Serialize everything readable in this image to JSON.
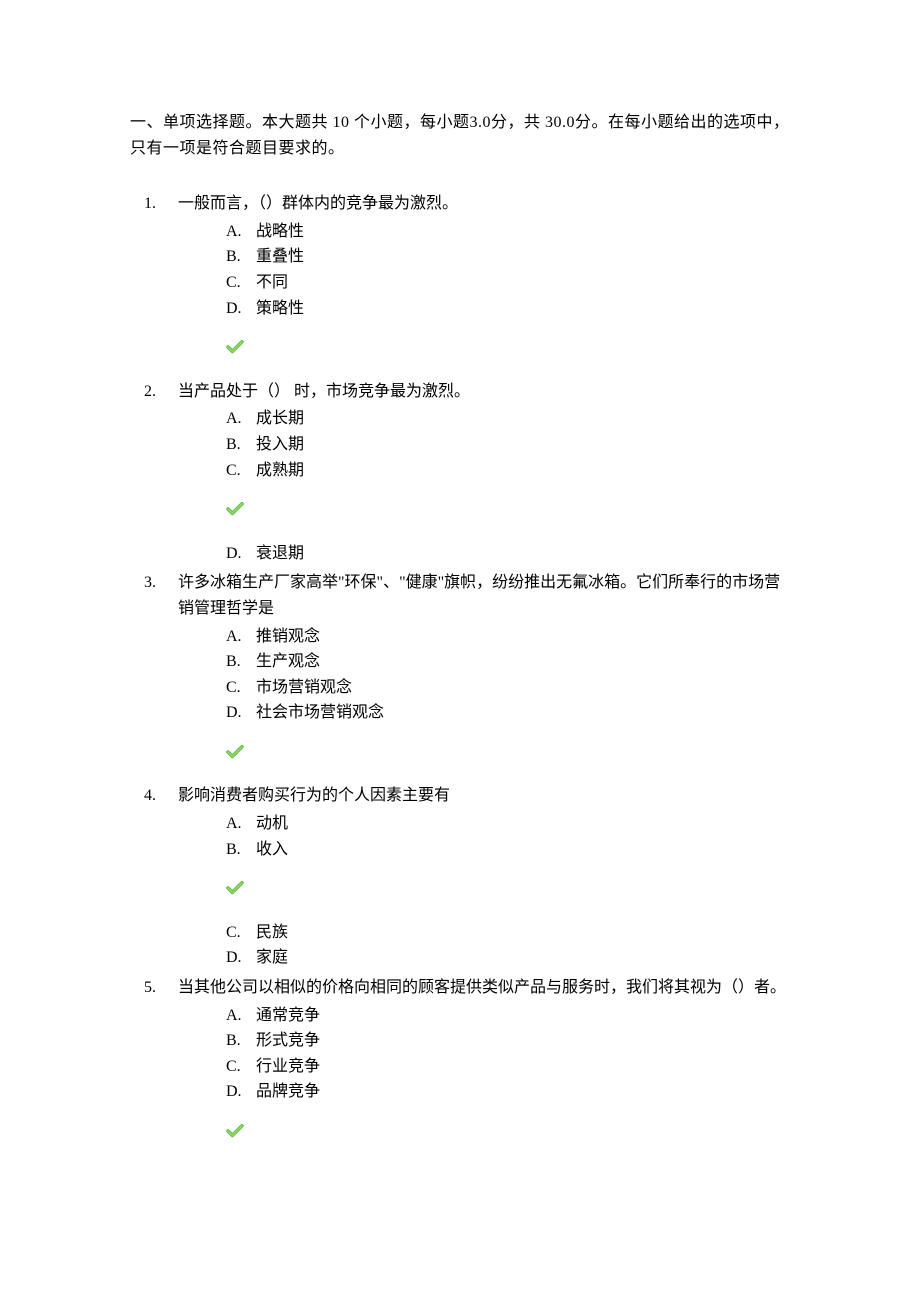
{
  "section_header": "一、单项选择题。本大题共 10 个小题，每小题3.0分，共 30.0分。在每小题给出的选项中，只有一项是符合题目要求的。",
  "questions": [
    {
      "num": "1.",
      "text": "一般而言，（）群体内的竞争最为激烈。",
      "options": [
        {
          "letter": "A.",
          "text": "战略性"
        },
        {
          "letter": "B.",
          "text": "重叠性"
        },
        {
          "letter": "C.",
          "text": "不同"
        },
        {
          "letter": "D.",
          "text": "策略性"
        }
      ],
      "check_after": true
    },
    {
      "num": "2.",
      "text": "当产品处于（） 时，市场竞争最为激烈。",
      "options_before": [
        {
          "letter": "A.",
          "text": "成长期"
        },
        {
          "letter": "B.",
          "text": "投入期"
        },
        {
          "letter": "C.",
          "text": "成熟期"
        }
      ],
      "check_mid": true,
      "options_after": [
        {
          "letter": "D.",
          "text": "衰退期"
        }
      ]
    },
    {
      "num": "3.",
      "text": "许多冰箱生产厂家高举\"环保\"、\"健康\"旗帜，纷纷推出无氟冰箱。它们所奉行的市场营销管理哲学是",
      "options": [
        {
          "letter": "A.",
          "text": "推销观念"
        },
        {
          "letter": "B.",
          "text": "生产观念"
        },
        {
          "letter": "C.",
          "text": "市场营销观念"
        },
        {
          "letter": "D.",
          "text": "社会市场营销观念"
        }
      ],
      "check_after": true
    },
    {
      "num": "4.",
      "text": "影响消费者购买行为的个人因素主要有",
      "options_before": [
        {
          "letter": "A.",
          "text": "动机"
        },
        {
          "letter": "B.",
          "text": "收入"
        }
      ],
      "check_mid": true,
      "options_after": [
        {
          "letter": "C.",
          "text": "民族"
        },
        {
          "letter": "D.",
          "text": "家庭"
        }
      ]
    },
    {
      "num": "5.",
      "text": "当其他公司以相似的价格向相同的顾客提供类似产品与服务时，我们将其视为（）者。",
      "options": [
        {
          "letter": "A.",
          "text": "通常竞争"
        },
        {
          "letter": "B.",
          "text": "形式竞争"
        },
        {
          "letter": "C.",
          "text": "行业竞争"
        },
        {
          "letter": "D.",
          "text": "品牌竞争"
        }
      ],
      "check_after": true
    }
  ]
}
